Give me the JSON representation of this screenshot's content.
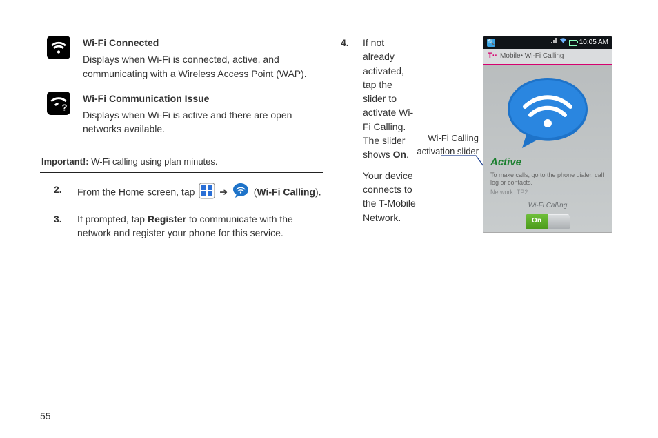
{
  "left": {
    "wifi_connected": {
      "title": "Wi-Fi Connected",
      "desc": "Displays when Wi-Fi is connected, active, and communicating with a Wireless Access Point (WAP)."
    },
    "wifi_issue": {
      "title": "Wi-Fi Communication Issue",
      "desc": "Displays when Wi-Fi is active and there are open networks available."
    },
    "important_label": "Important!:",
    "important_text": " W-Fi calling using plan minutes.",
    "step2": {
      "num": "2.",
      "pre": "From the Home screen, tap ",
      "arrow": "  ➔  ",
      "post_open": " (",
      "bold": "Wi-Fi Calling",
      "post_close": ")."
    },
    "step3": {
      "num": "3.",
      "pre": "If prompted, tap ",
      "bold": "Register",
      "post": " to communicate with the network and register your phone for this service."
    }
  },
  "right": {
    "step4": {
      "num": "4.",
      "l1": "If not already activated, tap the slider to activate Wi-Fi Calling. The slider shows ",
      "bold": "On",
      "l1_end": ".",
      "l2": "Your device connects to the T-Mobile Network."
    },
    "caption": "Wi-Fi Calling activation slider"
  },
  "phone": {
    "time": "10:05 AM",
    "app_title": "Mobile• Wi-Fi Calling",
    "active_label": "Active",
    "active_desc": "To make calls, go to the phone dialer, call log or contacts.",
    "network_line": "Network: TP2",
    "wifi_calling_label": "Wi-Fi Calling",
    "slider_on": "On"
  },
  "page_number": "55"
}
